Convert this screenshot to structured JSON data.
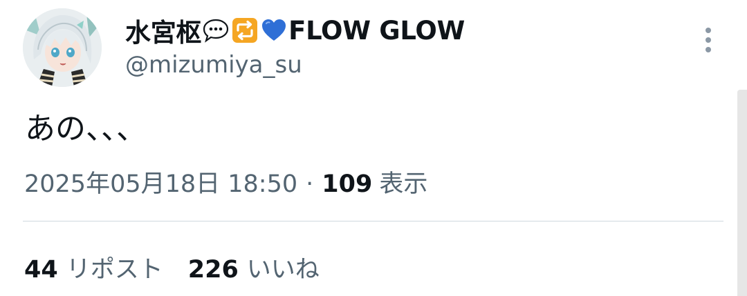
{
  "user": {
    "display_name": "水宮枢",
    "display_name_suffix": "FLOW GLOW",
    "name_emojis": [
      "speech-balloon-emoji",
      "repeat-emoji",
      "blue-heart-emoji"
    ],
    "handle": "@mizumiya_su",
    "avatar": "anime-girl-avatar"
  },
  "tweet": {
    "text": "あの、、、",
    "timestamp": "2025年05月18日 18:50",
    "separator": "·",
    "views_count": "109",
    "views_label": "表示"
  },
  "stats": {
    "reposts_count": "44",
    "reposts_label": "リポスト",
    "likes_count": "226",
    "likes_label": "いいね"
  },
  "colors": {
    "text_primary": "#0f1419",
    "text_secondary": "#536471",
    "divider": "#cfd9de",
    "repeat_emoji_bg": "#f5a623",
    "blue_heart": "#2f6fd6"
  }
}
